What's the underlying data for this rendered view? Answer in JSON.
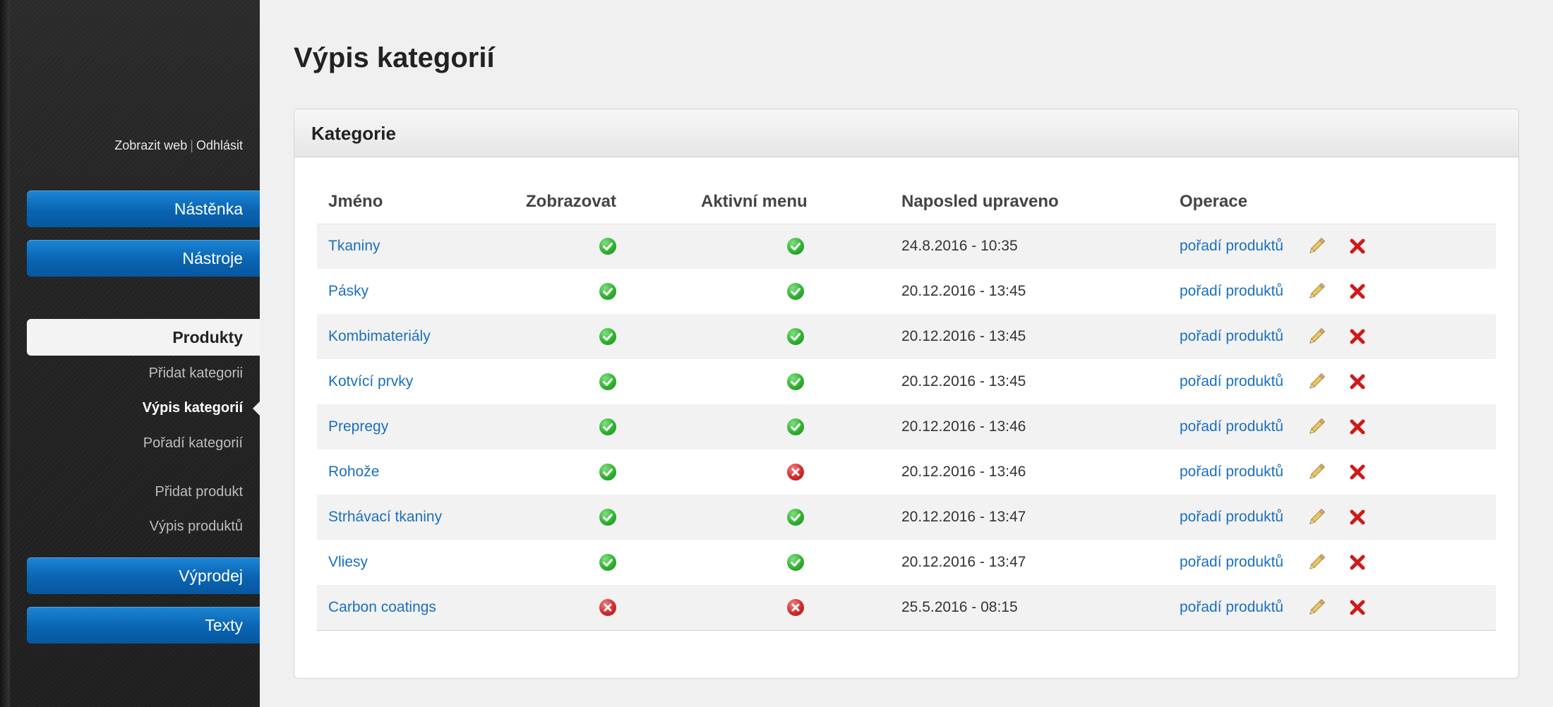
{
  "sidebar": {
    "top_links": {
      "view_site": "Zobrazit web",
      "separator": "|",
      "logout": "Odhlásit"
    },
    "nav": {
      "dashboard": "Nástěnka",
      "tools": "Nástroje",
      "products": "Produkty",
      "sale": "Výprodej",
      "texts": "Texty"
    },
    "sub_items": {
      "add_category": "Přidat kategorii",
      "list_categories": "Výpis kategorií",
      "order_categories": "Pořadí kategorií",
      "add_product": "Přidat produkt",
      "list_products": "Výpis produktů"
    }
  },
  "main": {
    "title": "Výpis kategorií",
    "panel_title": "Kategorie",
    "columns": {
      "name": "Jméno",
      "show": "Zobrazovat",
      "active_menu": "Aktivní menu",
      "modified": "Naposled upraveno",
      "operations": "Operace"
    },
    "rows": [
      {
        "name": "Tkaniny",
        "show": true,
        "active_menu": true,
        "modified": "24.8.2016 - 10:35",
        "order_link": "pořadí produktů"
      },
      {
        "name": "Pásky",
        "show": true,
        "active_menu": true,
        "modified": "20.12.2016 - 13:45",
        "order_link": "pořadí produktů"
      },
      {
        "name": "Kombimateriály",
        "show": true,
        "active_menu": true,
        "modified": "20.12.2016 - 13:45",
        "order_link": "pořadí produktů"
      },
      {
        "name": "Kotvící prvky",
        "show": true,
        "active_menu": true,
        "modified": "20.12.2016 - 13:45",
        "order_link": "pořadí produktů"
      },
      {
        "name": "Prepregy",
        "show": true,
        "active_menu": true,
        "modified": "20.12.2016 - 13:46",
        "order_link": "pořadí produktů"
      },
      {
        "name": "Rohože",
        "show": true,
        "active_menu": false,
        "modified": "20.12.2016 - 13:46",
        "order_link": "pořadí produktů"
      },
      {
        "name": "Strhávací tkaniny",
        "show": true,
        "active_menu": true,
        "modified": "20.12.2016 - 13:47",
        "order_link": "pořadí produktů"
      },
      {
        "name": "Vliesy",
        "show": true,
        "active_menu": true,
        "modified": "20.12.2016 - 13:47",
        "order_link": "pořadí produktů"
      },
      {
        "name": "Carbon coatings",
        "show": false,
        "active_menu": false,
        "modified": "25.5.2016 - 08:15",
        "order_link": "pořadí produktů"
      }
    ]
  },
  "icons": {
    "yes": "check-circle-icon",
    "no": "x-circle-icon",
    "edit": "pencil-icon",
    "delete": "delete-x-icon"
  },
  "colors": {
    "link": "#1a6fbf",
    "nav_blue": "#0a64b1",
    "ok_green": "#2fb12f",
    "error_red": "#d42a2a"
  }
}
